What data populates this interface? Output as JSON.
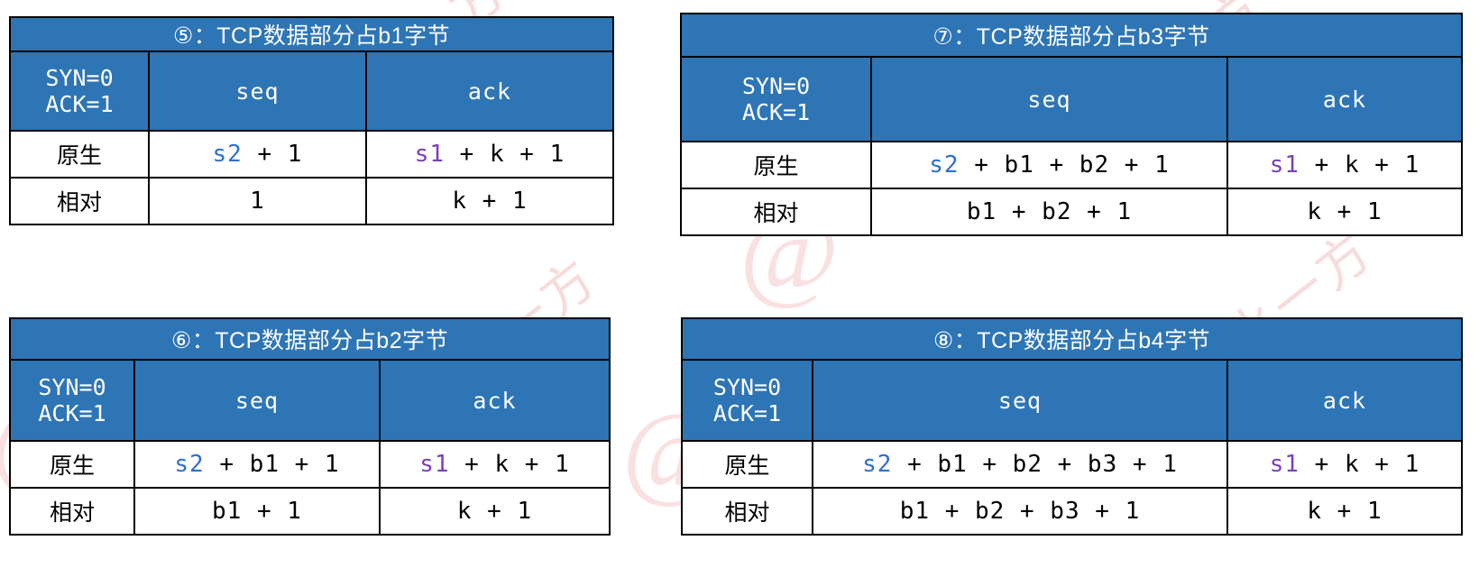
{
  "page": {
    "title_prefix_colon": "：",
    "blue": "#2E75B6",
    "var_s2_color": "#2E6FD0",
    "var_s1_color": "#7B3FB8"
  },
  "watermarks": [
    "在水一方",
    "@水一方",
    "在水一方",
    "@A"
  ],
  "tables": [
    {
      "id": "table-5",
      "title": "⑤：TCP数据部分占b1字节",
      "flag_line1": "SYN=0",
      "flag_line2": "ACK=1",
      "col_seq": "seq",
      "col_ack": "ack",
      "rows": [
        {
          "label": "原生",
          "seq_var": "s2",
          "seq_rest": " + 1",
          "ack_var": "s1",
          "ack_rest": " + k + 1"
        },
        {
          "label": "相对",
          "seq_var": "",
          "seq_rest": "1",
          "ack_var": "",
          "ack_rest": "k + 1"
        }
      ]
    },
    {
      "id": "table-7",
      "title": "⑦：TCP数据部分占b3字节",
      "flag_line1": "SYN=0",
      "flag_line2": "ACK=1",
      "col_seq": "seq",
      "col_ack": "ack",
      "rows": [
        {
          "label": "原生",
          "seq_var": "s2",
          "seq_rest": " + b1 + b2 + 1",
          "ack_var": "s1",
          "ack_rest": " + k + 1"
        },
        {
          "label": "相对",
          "seq_var": "",
          "seq_rest": "b1 + b2 + 1",
          "ack_var": "",
          "ack_rest": "k + 1"
        }
      ]
    },
    {
      "id": "table-6",
      "title": "⑥：TCP数据部分占b2字节",
      "flag_line1": "SYN=0",
      "flag_line2": "ACK=1",
      "col_seq": "seq",
      "col_ack": "ack",
      "rows": [
        {
          "label": "原生",
          "seq_var": "s2",
          "seq_rest": " + b1 + 1",
          "ack_var": "s1",
          "ack_rest": " + k + 1"
        },
        {
          "label": "相对",
          "seq_var": "",
          "seq_rest": "b1 + 1",
          "ack_var": "",
          "ack_rest": "k + 1"
        }
      ]
    },
    {
      "id": "table-8",
      "title": "⑧：TCP数据部分占b4字节",
      "flag_line1": "SYN=0",
      "flag_line2": "ACK=1",
      "col_seq": "seq",
      "col_ack": "ack",
      "rows": [
        {
          "label": "原生",
          "seq_var": "s2",
          "seq_rest": " + b1 + b2 + b3 + 1",
          "ack_var": "s1",
          "ack_rest": " + k + 1"
        },
        {
          "label": "相对",
          "seq_var": "",
          "seq_rest": "b1 + b2 + b3 + 1",
          "ack_var": "",
          "ack_rest": "k + 1"
        }
      ]
    }
  ]
}
